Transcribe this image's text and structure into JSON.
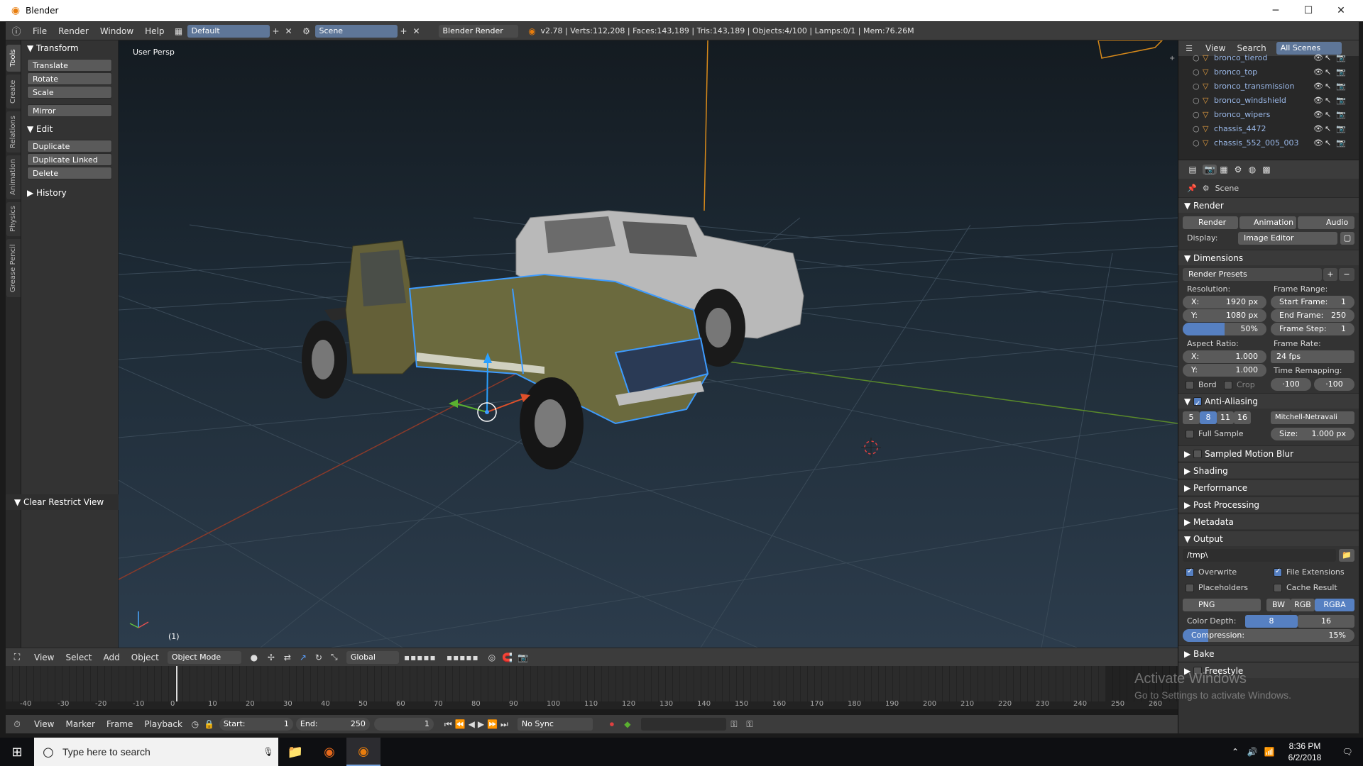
{
  "window": {
    "title": "Blender",
    "minimize": "─",
    "maximize": "☐",
    "close": "✕"
  },
  "topbar": {
    "menus": [
      "File",
      "Render",
      "Window",
      "Help"
    ],
    "layout": "Default",
    "scene": "Scene",
    "engine": "Blender Render",
    "stats": "v2.78 | Verts:112,208 | Faces:143,189 | Tris:143,189 | Objects:4/100 | Lamps:0/1 | Mem:76.26M"
  },
  "tooltabs": [
    "Tools",
    "Create",
    "Relations",
    "Animation",
    "Physics",
    "Grease Pencil"
  ],
  "toolshelf": {
    "transform_title": "Transform",
    "translate": "Translate",
    "rotate": "Rotate",
    "scale": "Scale",
    "mirror": "Mirror",
    "edit_title": "Edit",
    "duplicate": "Duplicate",
    "duplicate_linked": "Duplicate Linked",
    "delete": "Delete",
    "history_title": "History",
    "clear_restrict": "Clear Restrict View"
  },
  "viewport": {
    "label": "User Persp",
    "frame_label": "(1)"
  },
  "viewport_header": {
    "menus": [
      "View",
      "Select",
      "Add",
      "Object"
    ],
    "mode": "Object Mode",
    "orientation": "Global"
  },
  "timeline": {
    "ticks": [
      "-40",
      "-30",
      "-20",
      "-10",
      "0",
      "10",
      "20",
      "30",
      "40",
      "50",
      "60",
      "70",
      "80",
      "90",
      "100",
      "110",
      "120",
      "130",
      "140",
      "150",
      "160",
      "170",
      "180",
      "190",
      "200",
      "210",
      "220",
      "230",
      "240",
      "250",
      "260"
    ],
    "menus": [
      "View",
      "Marker",
      "Frame",
      "Playback"
    ],
    "start_label": "Start:",
    "start": "1",
    "end_label": "End:",
    "end": "250",
    "current": "1",
    "sync": "No Sync"
  },
  "outliner": {
    "tabs": [
      "View",
      "Search",
      "All Scenes"
    ],
    "items": [
      "bronco_tierod",
      "bronco_top",
      "bronco_transmission",
      "bronco_windshield",
      "bronco_wipers",
      "chassis_4472",
      "chassis_552_005_003"
    ]
  },
  "properties": {
    "breadcrumb": "Scene",
    "render_title": "Render",
    "render_btn": "Render",
    "animation_btn": "Animation",
    "audio_btn": "Audio",
    "display_label": "Display:",
    "display_value": "Image Editor",
    "dimensions_title": "Dimensions",
    "presets": "Render Presets",
    "resolution_label": "Resolution:",
    "res_x": "X:",
    "res_x_val": "1920 px",
    "res_y": "Y:",
    "res_y_val": "1080 px",
    "res_pct": "50%",
    "frame_range_label": "Frame Range:",
    "start_frame": "Start Frame:",
    "start_frame_val": "1",
    "end_frame": "End Frame:",
    "end_frame_val": "250",
    "frame_step": "Frame Step:",
    "frame_step_val": "1",
    "aspect_label": "Aspect Ratio:",
    "asp_x": "X:",
    "asp_x_val": "1.000",
    "asp_y": "Y:",
    "asp_y_val": "1.000",
    "frame_rate_label": "Frame Rate:",
    "fps": "24 fps",
    "time_remap_label": "Time Remapping:",
    "remap_old": "·100",
    "remap_new": "·100",
    "bord": "Bord",
    "crop": "Crop",
    "aa_title": "Anti-Aliasing",
    "aa_samples": [
      "5",
      "8",
      "11",
      "16"
    ],
    "aa_filter": "Mitchell-Netravali",
    "full_sample": "Full Sample",
    "size_label": "Size:",
    "size_val": "1.000 px",
    "motion_blur": "Sampled Motion Blur",
    "shading": "Shading",
    "performance": "Performance",
    "post_processing": "Post Processing",
    "metadata": "Metadata",
    "output_title": "Output",
    "output_path": "/tmp\\",
    "overwrite": "Overwrite",
    "file_extensions": "File Extensions",
    "placeholders": "Placeholders",
    "cache_result": "Cache Result",
    "format": "PNG",
    "bw": "BW",
    "rgb": "RGB",
    "rgba": "RGBA",
    "color_depth_label": "Color Depth:",
    "depth_8": "8",
    "depth_16": "16",
    "compression_label": "Compression:",
    "compression_val": "15%",
    "compression_fraction": 0.15,
    "bake": "Bake",
    "freestyle": "Freestyle"
  },
  "watermark": {
    "line1": "Activate Windows",
    "line2": "Go to Settings to activate Windows."
  },
  "taskbar": {
    "search_placeholder": "Type here to search",
    "time": "8:36 PM",
    "date": "6/2/2018"
  },
  "colors": {
    "accent": "#5680c2",
    "selection_outline": "#3d9bff",
    "blender_orange": "#e87d0d"
  }
}
